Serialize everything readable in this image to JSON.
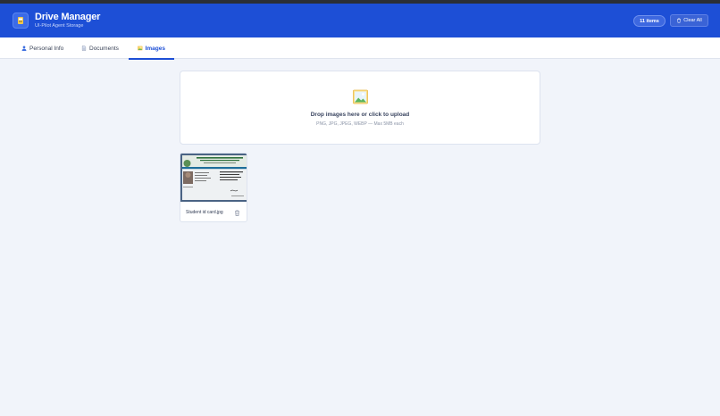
{
  "header": {
    "title": "Drive Manager",
    "subtitle": "UI-Pilot Agent Storage",
    "item_count": "11 items",
    "clear_label": "Clear All"
  },
  "tabs": [
    {
      "label": "Personal Info",
      "icon": "user-icon",
      "active": false
    },
    {
      "label": "Documents",
      "icon": "document-icon",
      "active": false
    },
    {
      "label": "Images",
      "icon": "image-icon",
      "active": true
    }
  ],
  "dropzone": {
    "title": "Drop images here or click to upload",
    "hint": "PNG, JPG, JPEG, WEBP — Max 5MB each"
  },
  "files": [
    {
      "name": "Student id card.jpg",
      "icon": "trash-icon"
    }
  ],
  "colors": {
    "accent": "#1d4fd6",
    "background": "#f1f4fa"
  }
}
